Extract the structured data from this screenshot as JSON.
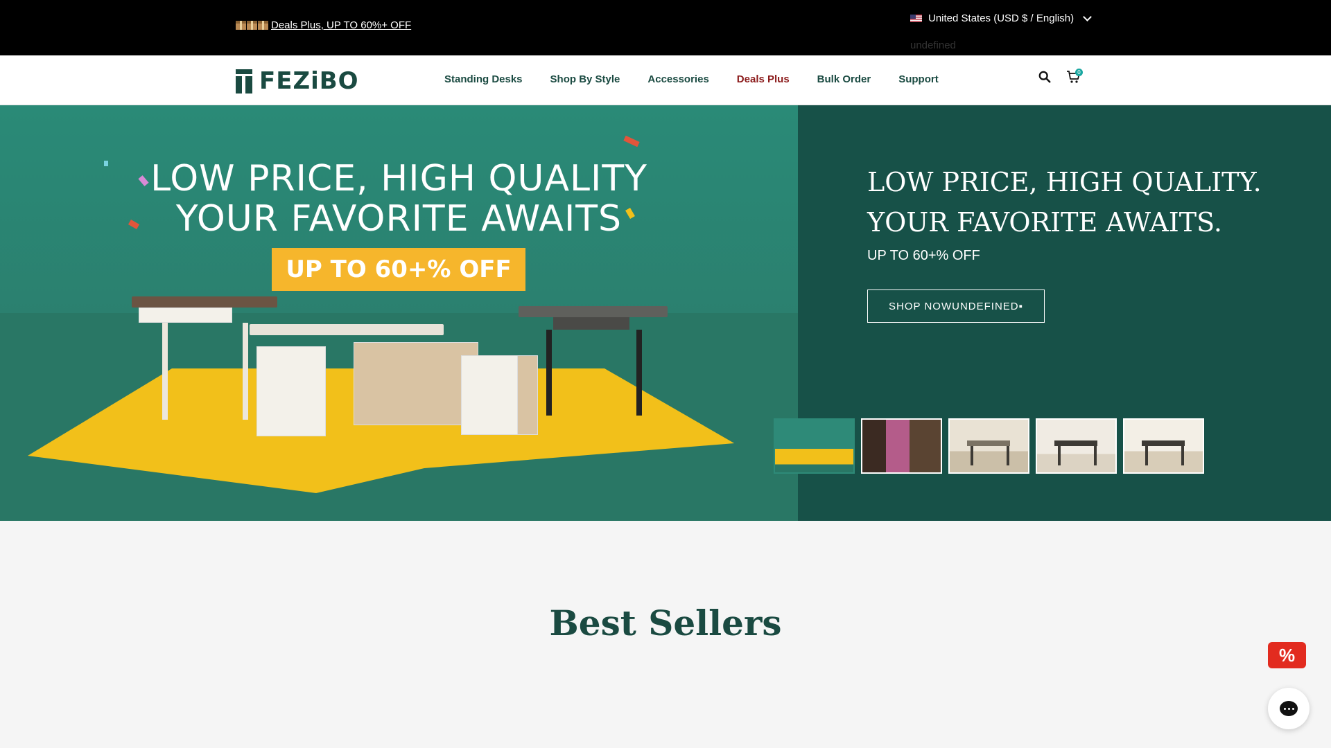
{
  "topbar": {
    "promo": "Deals Plus, UP TO 60%+ OFF",
    "locale": "United States (USD $ / English)",
    "locale_sub": "undefined"
  },
  "header": {
    "logo_text": "FEZiBO",
    "nav": [
      "Standing Desks",
      "Shop By Style",
      "Accessories",
      "Deals Plus",
      "Bulk Order",
      "Support"
    ],
    "cart_count": "0"
  },
  "hero": {
    "art_line1": "LOW PRICE, HIGH QUALITY",
    "art_line2": "YOUR FAVORITE AWAITS",
    "art_badge": "UP TO 60+% OFF",
    "heading_line1": "LOW PRICE, HIGH QUALITY.",
    "heading_line2": "YOUR FAVORITE AWAITS.",
    "subheading": "UP TO 60+% OFF",
    "cta": "SHOP NOWUNDEFINED▪"
  },
  "sections": {
    "best_sellers": "Best Sellers"
  },
  "floating": {
    "discount_symbol": "%"
  },
  "colors": {
    "brand": "#1a4a41",
    "hero_bg": "#175148",
    "deals": "#8b1a1a",
    "accent": "#1aa7a1",
    "badge": "#e22b1f"
  }
}
